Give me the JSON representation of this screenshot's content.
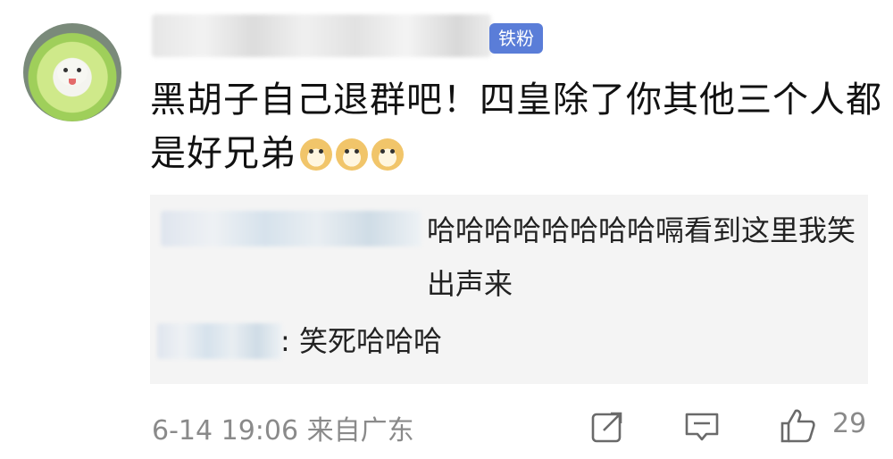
{
  "comment": {
    "badge": "铁粉",
    "text": "黑胡子自己退群吧！四皇除了你其他三个人都是好兄弟",
    "emoji": "doge-emoji"
  },
  "replies": [
    {
      "text": "哈哈哈哈哈哈哈哈嗝看到这里我笑出声来"
    },
    {
      "text": ": 笑死哈哈哈"
    }
  ],
  "footer": {
    "timestamp": "6-14 19:06 来自广东",
    "like_count": "29"
  },
  "icons": {
    "share": "share-icon",
    "comment": "comment-icon",
    "like": "thumbs-up-icon"
  },
  "colors": {
    "badge_bg": "#5a7dd8",
    "reply_bg": "#f4f4f4",
    "meta_text": "#8a8a8a"
  }
}
